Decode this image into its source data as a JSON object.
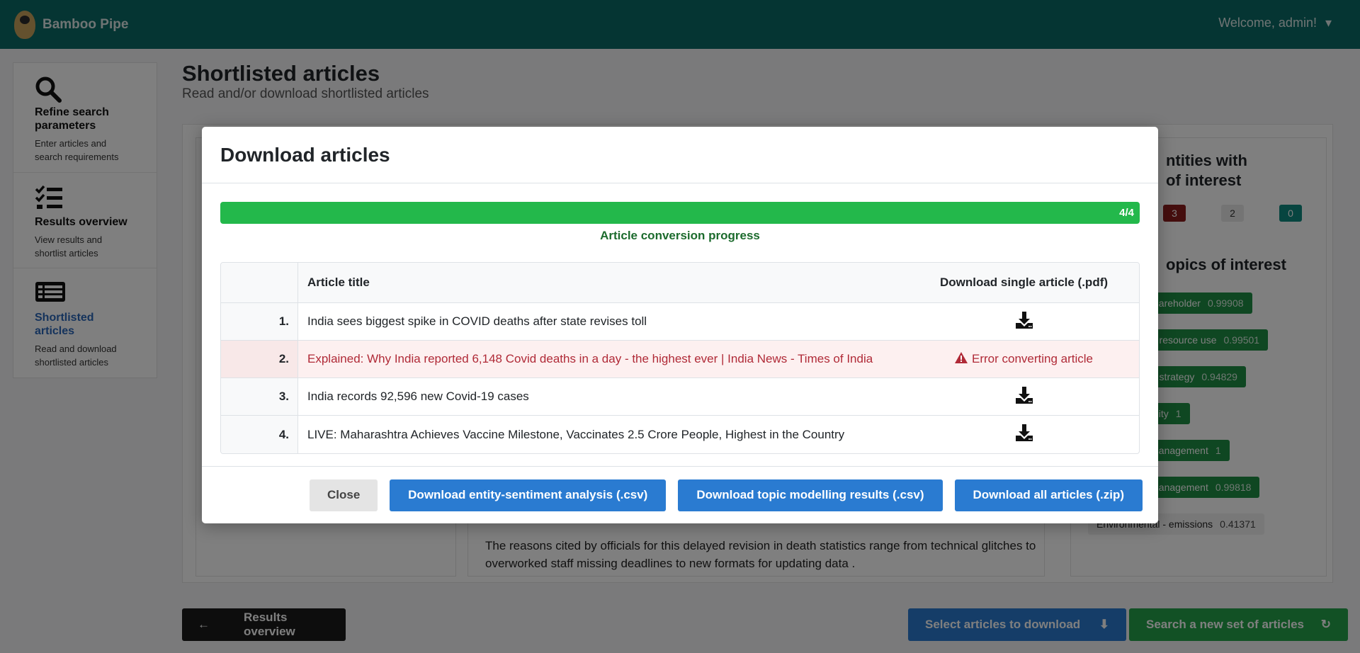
{
  "app": {
    "brand": "Bamboo Pipe",
    "welcome": "Welcome, admin!"
  },
  "sidebar": {
    "items": [
      {
        "title": "Refine search parameters",
        "subtitle": "Enter articles and search requirements",
        "icon": "search-icon",
        "active": false
      },
      {
        "title": "Results overview",
        "subtitle": "View results and shortlist articles",
        "icon": "checklist-icon",
        "active": false
      },
      {
        "title": "Shortlisted articles",
        "subtitle": "Read and download shortlisted articles",
        "icon": "list-icon",
        "active": true
      }
    ]
  },
  "main": {
    "title": "Shortlisted articles",
    "subtitle": "Read and/or download shortlisted articles",
    "article_excerpt": "The reasons cited by officials for this delayed revision in death statistics range from technical glitches to overworked staff missing deadlines to new formats for updating data .",
    "right_panel": {
      "entities_heading_line1": "ntities with",
      "entities_heading_line2": "of interest",
      "badges": [
        {
          "value": "3",
          "color": "#8b1d1d"
        },
        {
          "value": "2",
          "color": "#e9e9e9"
        },
        {
          "value": "0",
          "color": "#0e8a80"
        }
      ],
      "topics_heading": "opics of interest",
      "topics": [
        {
          "label": "hareholder",
          "score": "0.99908",
          "style": "green"
        },
        {
          "label": "- resource use",
          "score": "0.99501",
          "style": "green"
        },
        {
          "label": "r strategy",
          "score": "0.94829",
          "style": "green"
        },
        {
          "label": "nity",
          "score": "1",
          "style": "green"
        },
        {
          "label": "nanagement",
          "score": "1",
          "style": "green"
        },
        {
          "label": "nanagement",
          "score": "0.99818",
          "style": "green"
        },
        {
          "label": "Environmental - emissions",
          "score": "0.41371",
          "style": "light"
        }
      ]
    },
    "buttons": {
      "back": "Results overview",
      "select_download": "Select articles to download",
      "new_search": "Search a new set of articles"
    }
  },
  "modal": {
    "title": "Download articles",
    "progress": {
      "label": "4/4",
      "fraction": 1.0,
      "caption": "Article conversion progress"
    },
    "table": {
      "headers": {
        "title": "Article title",
        "download": "Download single article (.pdf)"
      },
      "rows": [
        {
          "num": "1.",
          "title": "India sees biggest spike in COVID deaths after state revises toll",
          "status": "ok"
        },
        {
          "num": "2.",
          "title": "Explained: Why India reported 6,148 Covid deaths in a day - the highest ever | India News - Times of India",
          "status": "error",
          "error_text": "Error converting article"
        },
        {
          "num": "3.",
          "title": "India records 92,596 new Covid-19 cases",
          "status": "ok"
        },
        {
          "num": "4.",
          "title": "LIVE: Maharashtra Achieves Vaccine Milestone, Vaccinates 2.5 Crore People, Highest in the Country",
          "status": "ok"
        }
      ]
    },
    "footer": {
      "close": "Close",
      "download_sentiment": "Download entity-sentiment analysis (.csv)",
      "download_topics": "Download topic modelling results (.csv)",
      "download_all": "Download all articles (.zip)"
    }
  }
}
